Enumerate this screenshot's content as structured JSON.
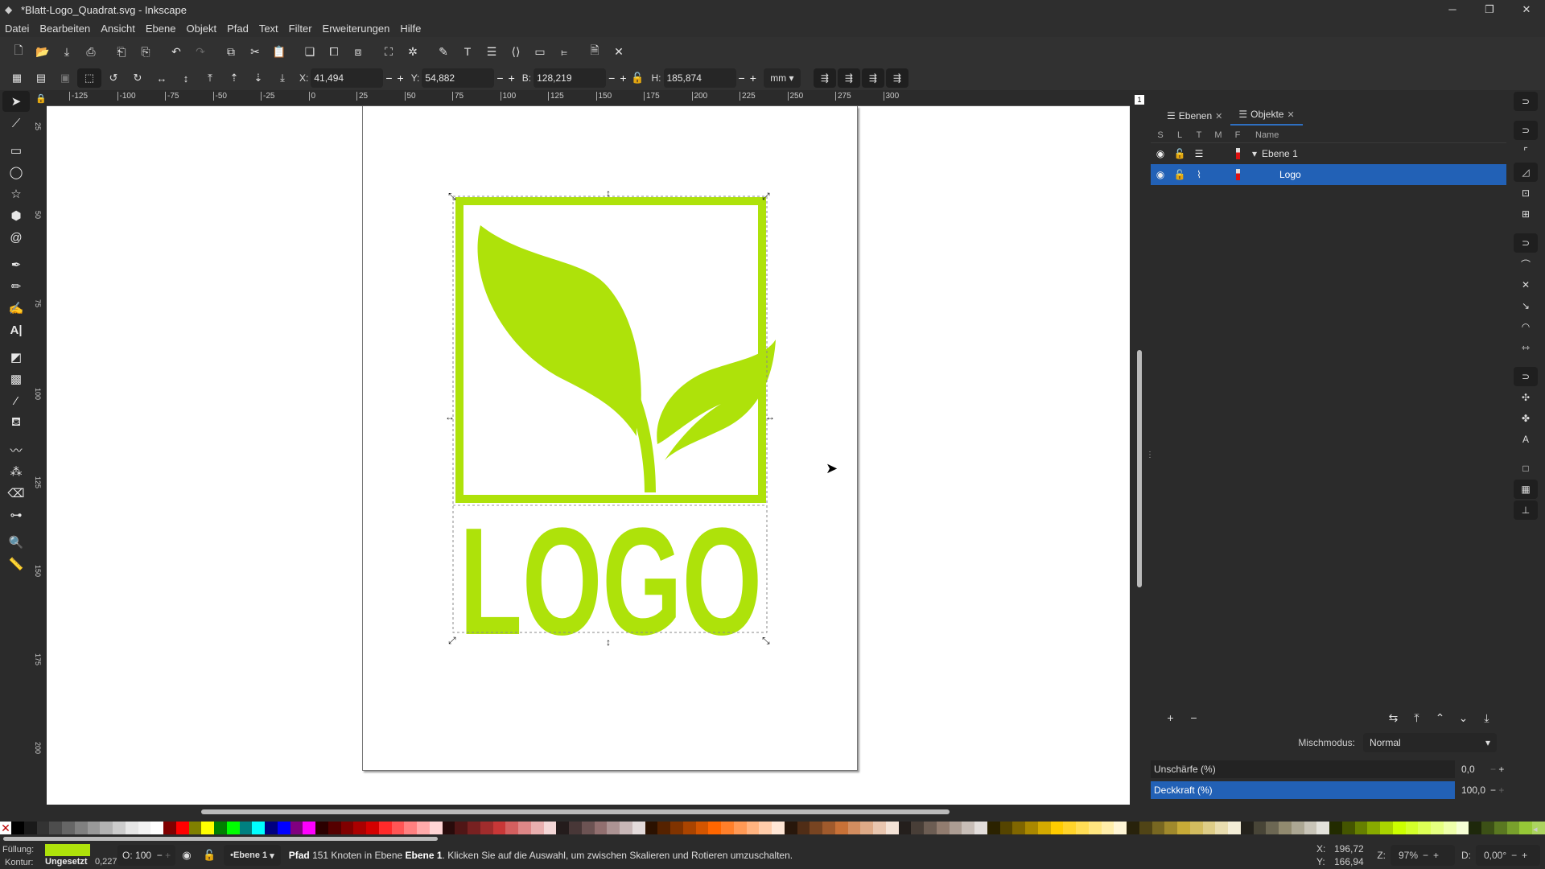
{
  "window": {
    "title": "*Blatt-Logo_Quadrat.svg - Inkscape",
    "controls": [
      "minimize",
      "maximize",
      "close"
    ]
  },
  "menu": [
    "Datei",
    "Bearbeiten",
    "Ansicht",
    "Ebene",
    "Objekt",
    "Pfad",
    "Text",
    "Filter",
    "Erweiterungen",
    "Hilfe"
  ],
  "commands_bar": {
    "icons": [
      "new-document-icon",
      "open-icon",
      "save-icon",
      "print-icon",
      "import-icon",
      "export-icon",
      "undo-icon",
      "redo-icon",
      "copy-icon",
      "cut-icon",
      "paste-icon",
      "duplicate-icon",
      "clone-icon",
      "unlink-clone-icon",
      "group-icon",
      "ungroup-icon",
      "fill-stroke-icon",
      "text-font-icon",
      "layers-icon",
      "xml-editor-icon",
      "object-properties-icon",
      "align-distribute-icon",
      "document-properties-icon",
      "preferences-icon"
    ]
  },
  "tool_controls": {
    "x_label": "X:",
    "x_value": "41,494",
    "y_label": "Y:",
    "y_value": "54,882",
    "w_label": "B:",
    "w_value": "128,219",
    "h_label": "H:",
    "h_value": "185,874",
    "unit": "mm",
    "minus": "−",
    "plus": "+"
  },
  "toolbox": [
    "selector",
    "node",
    "rectangle",
    "ellipse",
    "star-polygon",
    "3d-box",
    "spiral",
    "bezier",
    "pencil",
    "calligraphy",
    "text",
    "gradient",
    "mesh",
    "dropper",
    "paint-bucket",
    "tweak",
    "spray",
    "eraser",
    "connector",
    "zoom",
    "measure"
  ],
  "rulers": {
    "horizontal": [
      "-125",
      "-100",
      "-75",
      "-50",
      "-25",
      "0",
      "25",
      "50",
      "75",
      "100",
      "125",
      "150",
      "175",
      "200",
      "225",
      "250",
      "275",
      "300"
    ],
    "vertical": [
      "25",
      "50",
      "75",
      "100",
      "125",
      "150",
      "175",
      "200"
    ],
    "page_badge": "1"
  },
  "canvas": {
    "logo_text": "LOGO",
    "logo_color": "#aee20a"
  },
  "dock": {
    "tabs": [
      {
        "label": "Ebenen",
        "active": false
      },
      {
        "label": "Objekte",
        "active": true
      }
    ],
    "columns": [
      "S",
      "L",
      "T",
      "M",
      "F",
      "Name"
    ],
    "rows": [
      {
        "name": "Ebene 1",
        "expanded": true,
        "selected": false
      },
      {
        "name": "Logo",
        "selected": true
      }
    ],
    "blend_label": "Mischmodus:",
    "blend_value": "Normal",
    "blur_label": "Unschärfe (%)",
    "blur_value": "0,0",
    "opacity_label": "Deckkraft (%)",
    "opacity_value": "100,0",
    "add": "+",
    "remove": "−"
  },
  "palette": {
    "colors": [
      "#000000",
      "#1a1a1a",
      "#333333",
      "#4d4d4d",
      "#666666",
      "#808080",
      "#999999",
      "#b3b3b3",
      "#cccccc",
      "#e6e6e6",
      "#f2f2f2",
      "#ffffff",
      "#800000",
      "#ff0000",
      "#808000",
      "#ffff00",
      "#008000",
      "#00ff00",
      "#008080",
      "#00ffff",
      "#000080",
      "#0000ff",
      "#800080",
      "#ff00ff",
      "#2b0000",
      "#550000",
      "#800000",
      "#aa0000",
      "#d40000",
      "#ff2a2a",
      "#ff5555",
      "#ff8080",
      "#ffaaaa",
      "#ffd5d5",
      "#280b0b",
      "#501616",
      "#782121",
      "#a02c2c",
      "#c83737",
      "#d35f5f",
      "#de8787",
      "#e9afaf",
      "#f4d7d7",
      "#241c1c",
      "#483737",
      "#6c5353",
      "#916f6f",
      "#ac9393",
      "#c8b7b7",
      "#e3dbdb",
      "#2b1100",
      "#552200",
      "#803300",
      "#aa4400",
      "#d45500",
      "#ff6600",
      "#ff7f2a",
      "#ff9955",
      "#ffb380",
      "#ffccaa",
      "#ffe6d5",
      "#28170b",
      "#502d16",
      "#784421",
      "#a05a2c",
      "#c87137",
      "#d38d5f",
      "#deaa87",
      "#e9c6af",
      "#f4e3d7",
      "#241f1c",
      "#483e37",
      "#6c5d53",
      "#917c6f",
      "#ac9d93",
      "#c8beb7",
      "#e3dedb",
      "#2b2200",
      "#554400",
      "#806600",
      "#aa8800",
      "#d4aa00",
      "#ffcc00",
      "#ffd42a",
      "#ffdd55",
      "#ffe680",
      "#ffeeaa",
      "#fff6d5",
      "#28220b",
      "#504416",
      "#786721",
      "#a0892c",
      "#c8ab37",
      "#d3bc5f",
      "#decd87",
      "#e9ddaf",
      "#f4eed7",
      "#24221c",
      "#484537",
      "#6c6753",
      "#918a6f",
      "#aca793",
      "#c8c4b7",
      "#e3e2db",
      "#222b00",
      "#445500",
      "#668000",
      "#88aa00",
      "#aad400",
      "#ccff00",
      "#d4ff2a",
      "#ddff55",
      "#e5ff80",
      "#eeffaa",
      "#f6ffd5",
      "#1e280b",
      "#3c5016",
      "#5a7821",
      "#78a02c",
      "#96c837",
      "#abd35f"
    ]
  },
  "status": {
    "fill_label": "Füllung:",
    "fill_color": "#aee20a",
    "stroke_label": "Kontur:",
    "stroke_value": "Ungesetzt",
    "stroke_width": "0,227",
    "opacity_label": "O:",
    "opacity_value": "100",
    "layer": "•Ebene 1",
    "message_type": "Pfad",
    "message_mid": " 151 Knoten in Ebene ",
    "message_layer": "Ebene 1",
    "message_tail": ". Klicken Sie auf die Auswahl, um zwischen Skalieren und Rotieren umzuschalten.",
    "cursor_x_label": "X:",
    "cursor_x": "196,72",
    "cursor_y_label": "Y:",
    "cursor_y": "166,94",
    "zoom_label": "Z:",
    "zoom": "97%",
    "rotation_label": "D:",
    "rotation": "0,00°"
  }
}
